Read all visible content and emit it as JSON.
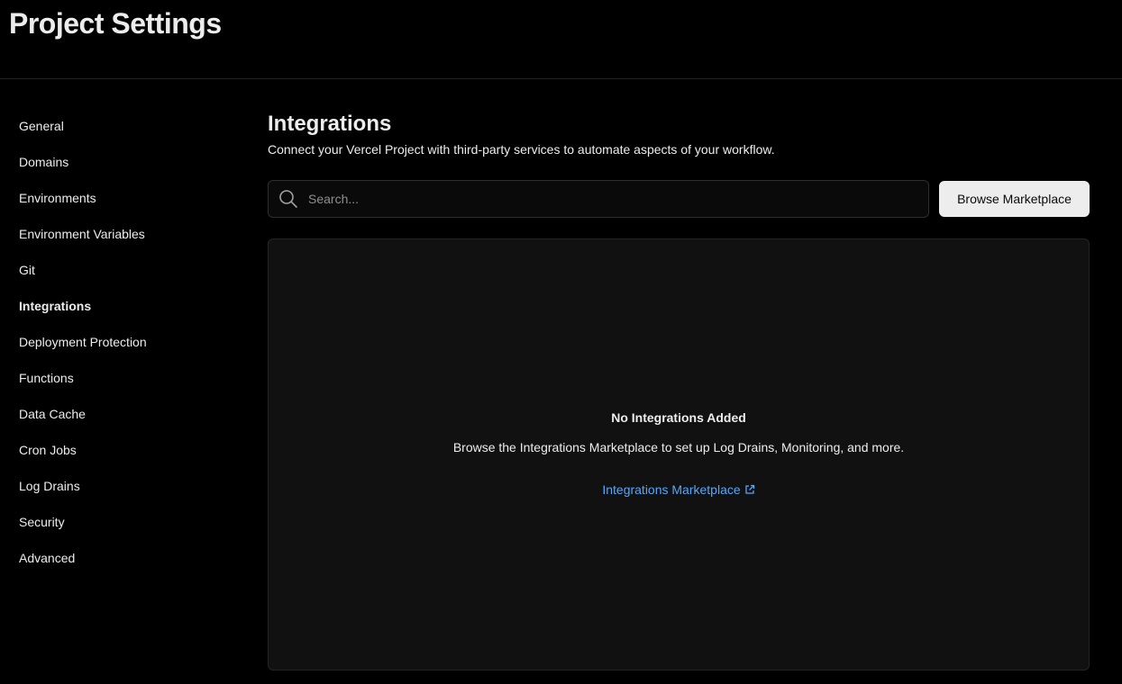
{
  "header": {
    "title": "Project Settings"
  },
  "sidebar": {
    "items": [
      {
        "label": "General",
        "active": false
      },
      {
        "label": "Domains",
        "active": false
      },
      {
        "label": "Environments",
        "active": false
      },
      {
        "label": "Environment Variables",
        "active": false
      },
      {
        "label": "Git",
        "active": false
      },
      {
        "label": "Integrations",
        "active": true
      },
      {
        "label": "Deployment Protection",
        "active": false
      },
      {
        "label": "Functions",
        "active": false
      },
      {
        "label": "Data Cache",
        "active": false
      },
      {
        "label": "Cron Jobs",
        "active": false
      },
      {
        "label": "Log Drains",
        "active": false
      },
      {
        "label": "Security",
        "active": false
      },
      {
        "label": "Advanced",
        "active": false
      }
    ]
  },
  "main": {
    "title": "Integrations",
    "description": "Connect your Vercel Project with third-party services to automate aspects of your workflow.",
    "search": {
      "placeholder": "Search...",
      "value": "",
      "icon": "search-icon"
    },
    "browse_button": "Browse Marketplace",
    "empty_state": {
      "title": "No Integrations Added",
      "description": "Browse the Integrations Marketplace to set up Log Drains, Monitoring, and more.",
      "link_label": "Integrations Marketplace",
      "link_icon": "external-link-icon"
    }
  },
  "colors": {
    "background": "#000000",
    "panel": "#111111",
    "text": "#ededed",
    "link": "#52a8ff",
    "button_bg": "#ededed"
  }
}
